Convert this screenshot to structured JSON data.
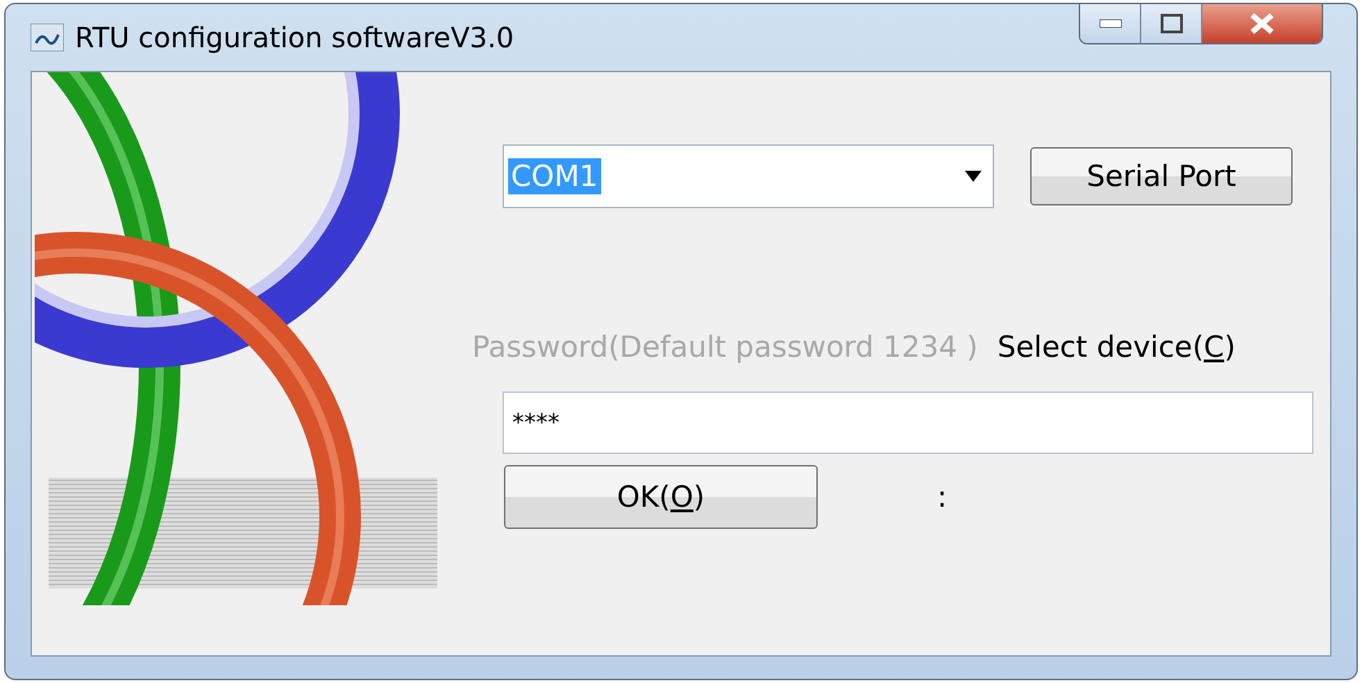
{
  "window": {
    "title": "RTU configuration softwareV3.0"
  },
  "port": {
    "value": "COM1",
    "highlighted": true
  },
  "serial_port_button": {
    "label": "Serial Port"
  },
  "password_label": {
    "text": "Password(Default password 1234 )",
    "disabled": true
  },
  "select_device": {
    "before": "Select device(",
    "key": "C",
    "after": ")"
  },
  "password_field": {
    "value": "****"
  },
  "ok_button": {
    "before": "OK(",
    "key": "O",
    "after": ")"
  },
  "status_text": ":"
}
